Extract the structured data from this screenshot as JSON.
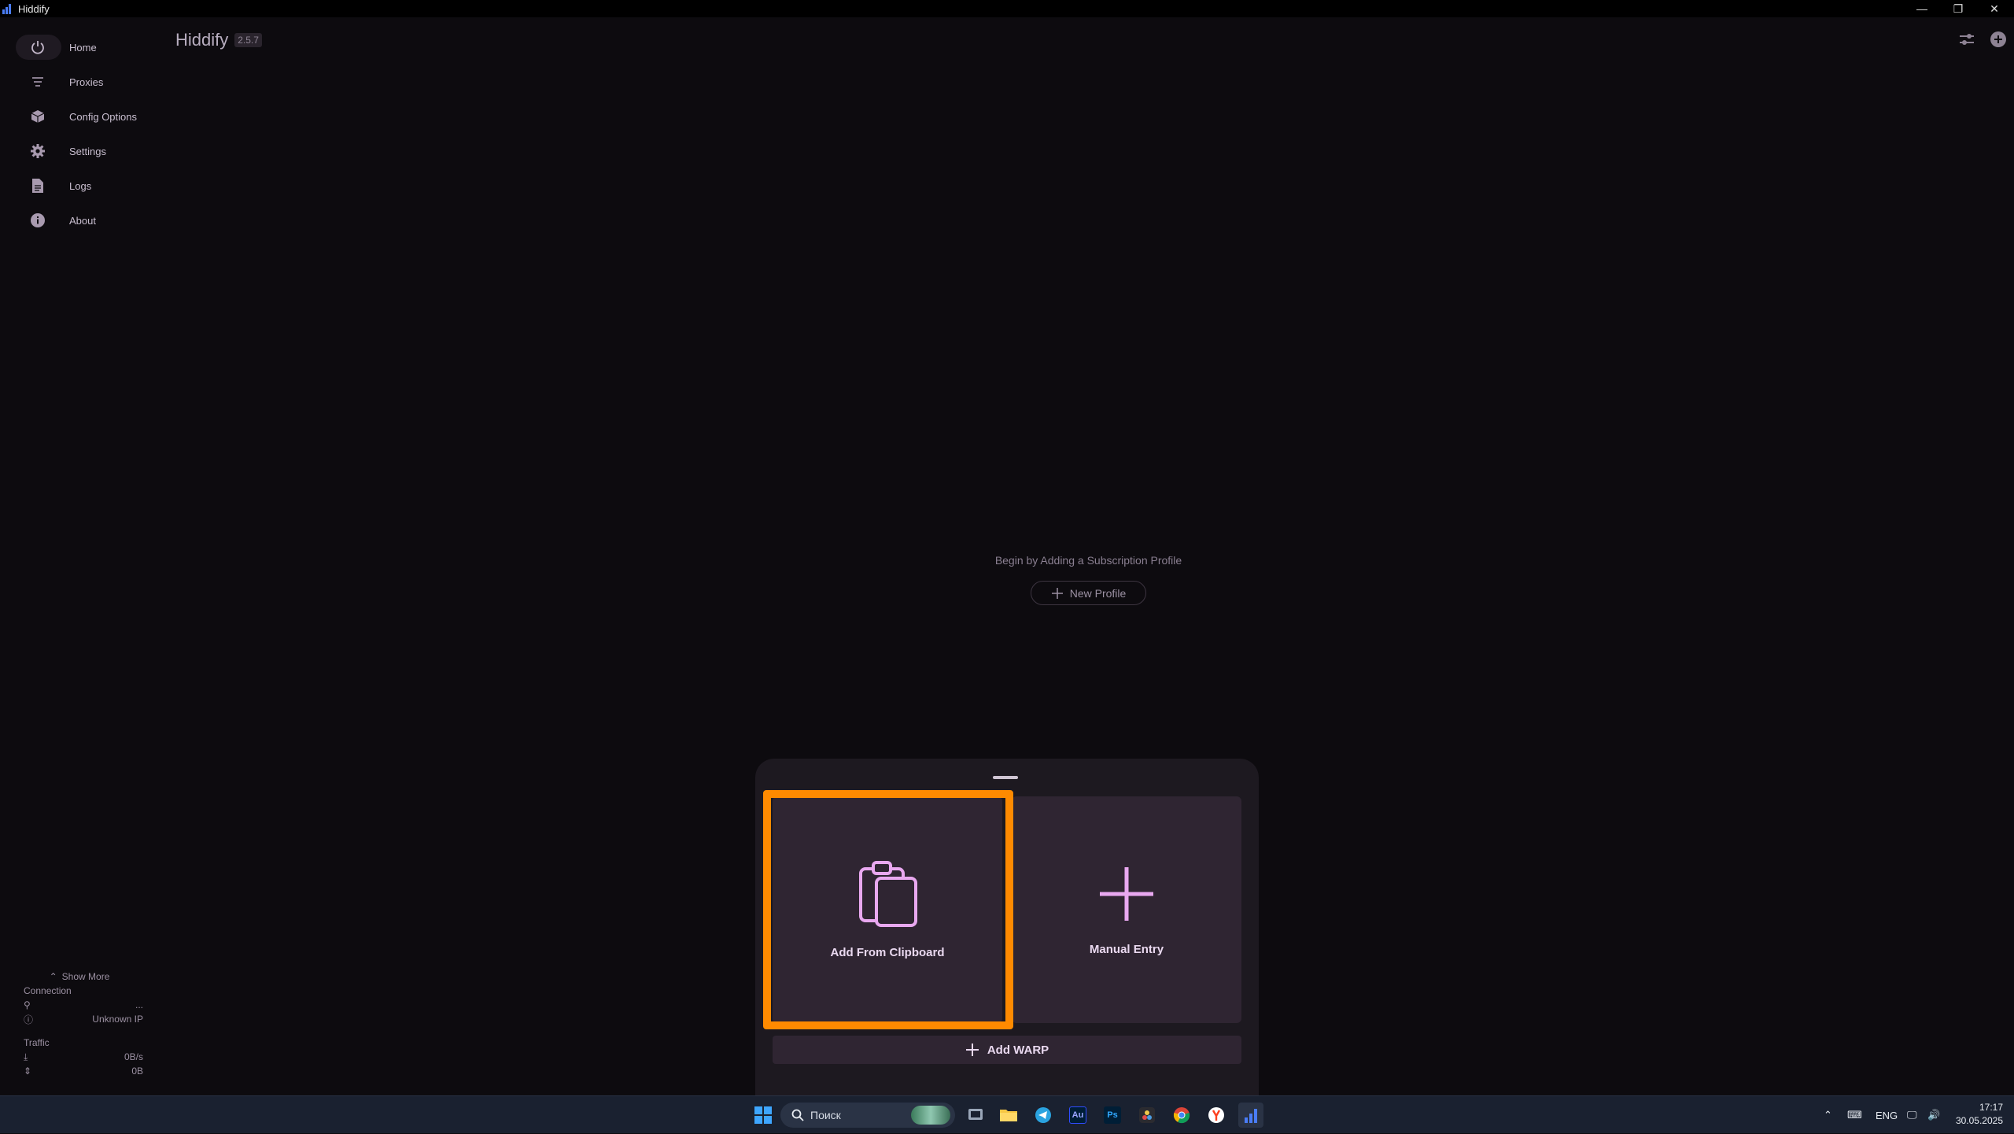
{
  "window": {
    "title": "Hiddify",
    "minimize": "—",
    "maximize": "❐",
    "close": "✕"
  },
  "app": {
    "name": "Hiddify",
    "version": "2.5.7"
  },
  "sidebar": {
    "items": [
      {
        "label": "Home",
        "icon": "power-icon"
      },
      {
        "label": "Proxies",
        "icon": "filter-list-icon"
      },
      {
        "label": "Config Options",
        "icon": "box-icon"
      },
      {
        "label": "Settings",
        "icon": "gear-icon"
      },
      {
        "label": "Logs",
        "icon": "document-icon"
      },
      {
        "label": "About",
        "icon": "info-icon"
      }
    ],
    "show_more": "Show More",
    "connection": {
      "title": "Connection",
      "status": "...",
      "ip": "Unknown IP"
    },
    "traffic": {
      "title": "Traffic",
      "speed": "0B/s",
      "total": "0B"
    }
  },
  "main": {
    "empty_text": "Begin by Adding a Subscription Profile",
    "new_profile": "New Profile"
  },
  "sheet": {
    "add_clipboard": "Add From Clipboard",
    "manual_entry": "Manual Entry",
    "add_warp": "Add WARP"
  },
  "taskbar": {
    "search_placeholder": "Поиск",
    "lang": "ENG",
    "time": "17:17",
    "date": "30.05.2025"
  },
  "colors": {
    "accent": "#ff8a00",
    "card": "#2f2532",
    "icon": "#e9a8f0"
  }
}
